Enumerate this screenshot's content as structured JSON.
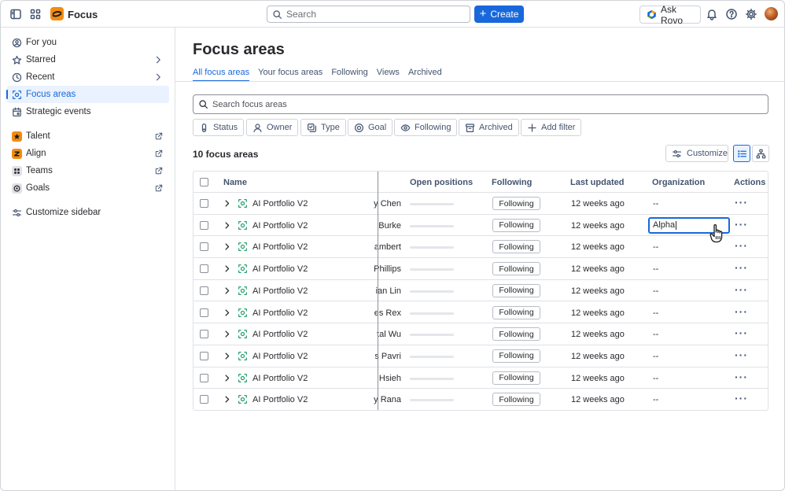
{
  "app": {
    "name": "Focus"
  },
  "topbar": {
    "search_placeholder": "Search",
    "create_label": "Create",
    "rovo_label": "Ask Rovo"
  },
  "sidebar": {
    "items": [
      {
        "label": "For you",
        "icon": "user-circle-icon"
      },
      {
        "label": "Starred",
        "icon": "star-icon"
      },
      {
        "label": "Recent",
        "icon": "clock-icon"
      },
      {
        "label": "Focus areas",
        "icon": "focus-icon"
      },
      {
        "label": "Strategic events",
        "icon": "calendar-icon"
      }
    ],
    "apps": [
      {
        "label": "Talent",
        "icon": "talent-icon",
        "color": "#f18c12"
      },
      {
        "label": "Align",
        "icon": "align-icon",
        "color": "#f18c12"
      },
      {
        "label": "Teams",
        "icon": "teams-icon",
        "color": "#dfe1e6"
      },
      {
        "label": "Goals",
        "icon": "goals-icon",
        "color": "#dfe1e6"
      }
    ],
    "customize_label": "Customize sidebar"
  },
  "page": {
    "title": "Focus areas",
    "tabs": [
      "All focus areas",
      "Your focus areas",
      "Following",
      "Views",
      "Archived"
    ],
    "search_placeholder": "Search focus areas",
    "filters": [
      "Status",
      "Owner",
      "Type",
      "Goal",
      "Following",
      "Archived",
      "Add filter"
    ],
    "count_label": "10 focus areas",
    "customize_label": "Customize"
  },
  "table": {
    "headers": {
      "name": "Name",
      "open_positions": "Open positions",
      "following": "Following",
      "last_updated": "Last updated",
      "organization": "Organization",
      "actions": "Actions"
    },
    "rows": [
      {
        "name": "AI Portfolio V2",
        "owner": "y Chen",
        "following": "Following",
        "updated": "12 weeks ago",
        "org": "--"
      },
      {
        "name": "AI Portfolio V2",
        "owner": "Burke",
        "following": "Following",
        "updated": "12 weeks ago",
        "org": "Alpha"
      },
      {
        "name": "AI Portfolio V2",
        "owner": "ambert",
        "following": "Following",
        "updated": "12 weeks ago",
        "org": "--"
      },
      {
        "name": "AI Portfolio V2",
        "owner": "Phillips",
        "following": "Following",
        "updated": "12 weeks ago",
        "org": "--"
      },
      {
        "name": "AI Portfolio V2",
        "owner": "ian Lin",
        "following": "Following",
        "updated": "12 weeks ago",
        "org": "--"
      },
      {
        "name": "AI Portfolio V2",
        "owner": "es Rex",
        "following": "Following",
        "updated": "12 weeks ago",
        "org": "--"
      },
      {
        "name": "AI Portfolio V2",
        "owner": "tal Wu",
        "following": "Following",
        "updated": "12 weeks ago",
        "org": "--"
      },
      {
        "name": "AI Portfolio V2",
        "owner": "s Pavri",
        "following": "Following",
        "updated": "12 weeks ago",
        "org": "--"
      },
      {
        "name": "AI Portfolio V2",
        "owner": "Hsieh",
        "following": "Following",
        "updated": "12 weeks ago",
        "org": "--"
      },
      {
        "name": "AI Portfolio V2",
        "owner": "y Rana",
        "following": "Following",
        "updated": "12 weeks ago",
        "org": "--"
      }
    ],
    "actions_glyph": "···"
  }
}
